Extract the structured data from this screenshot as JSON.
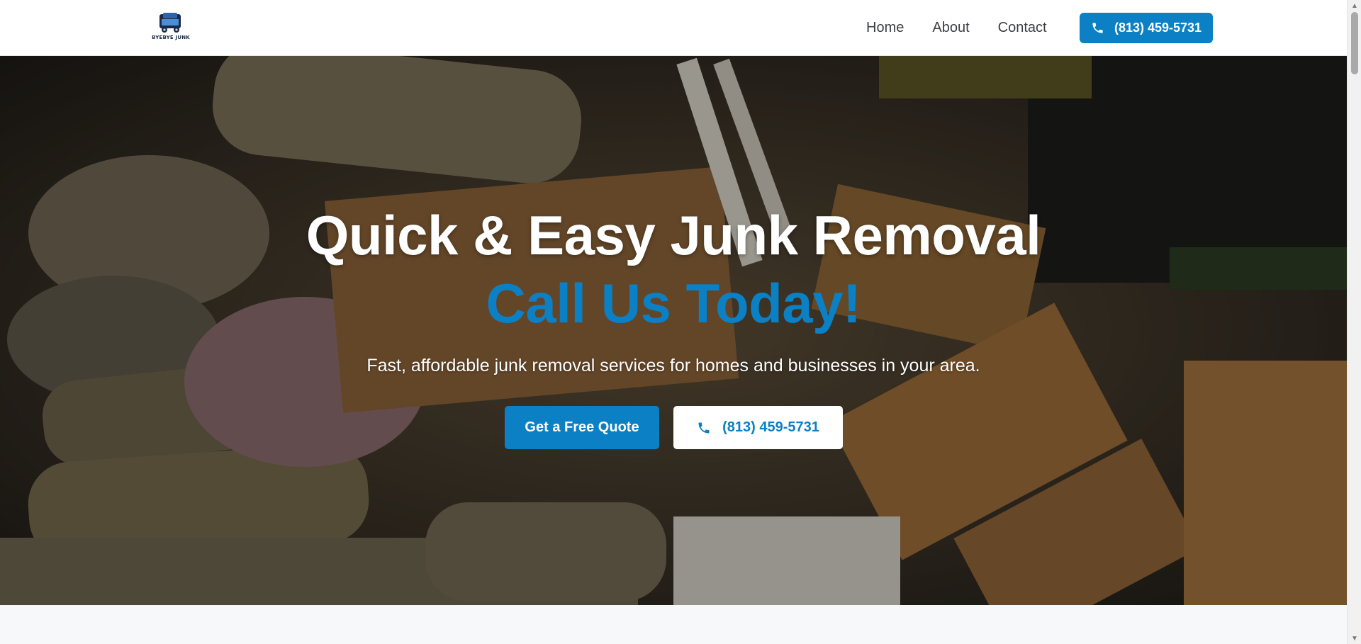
{
  "header": {
    "logo_text": "BYEBYE JUNK",
    "nav": [
      {
        "label": "Home"
      },
      {
        "label": "About"
      },
      {
        "label": "Contact"
      }
    ],
    "phone_button": {
      "label": "(813) 459-5731",
      "icon": "phone-icon"
    }
  },
  "hero": {
    "title": "Quick & Easy Junk Removal",
    "subtitle": "Call Us Today!",
    "description": "Fast, affordable junk removal services for homes and businesses in your area.",
    "quote_button": "Get a Free Quote",
    "call_button": {
      "label": "(813) 459-5731",
      "icon": "phone-icon"
    }
  },
  "colors": {
    "accent": "#0b80c4",
    "header_bg": "#ffffff",
    "nav_text": "#3b3f46",
    "page_bg": "#f7f8fa"
  }
}
